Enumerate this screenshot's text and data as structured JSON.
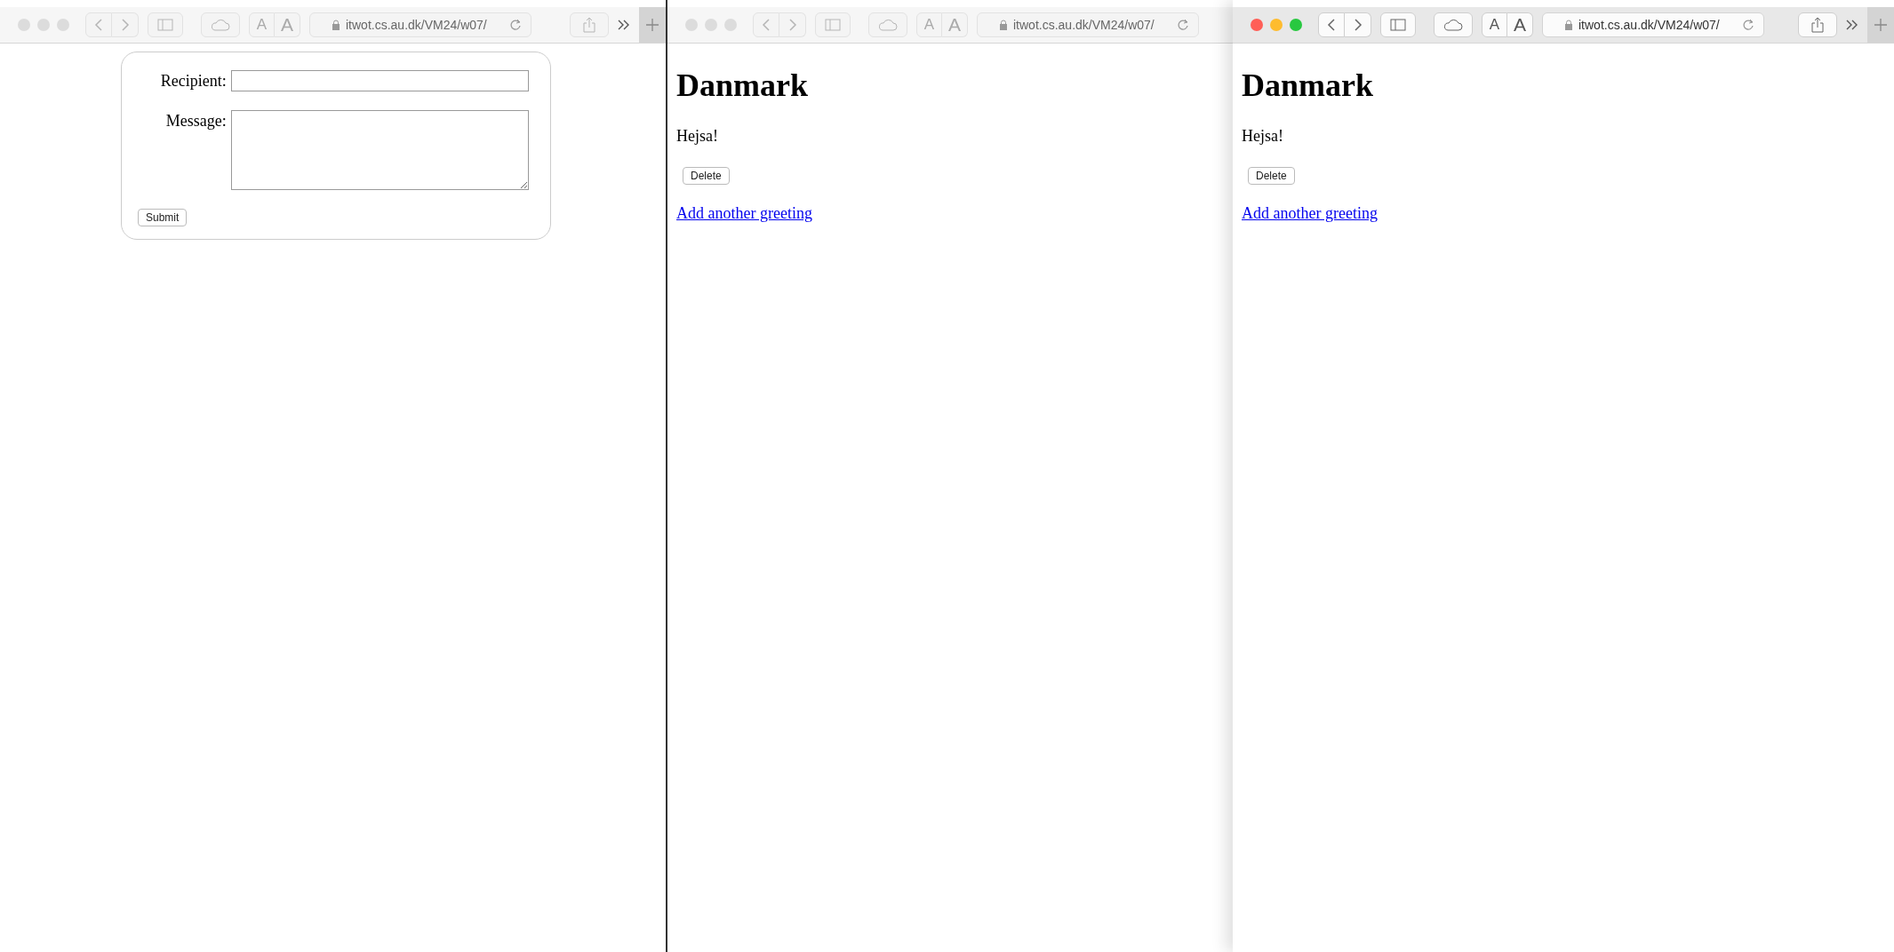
{
  "windows": [
    {
      "active": false,
      "toolbar": {
        "text_size_buttons": [
          "A",
          "A"
        ],
        "url": "itwot.cs.au.dk/VM24/w07/",
        "show_right_buttons": true
      },
      "page": {
        "kind": "form",
        "fields": [
          {
            "label": "Recipient:",
            "kind": "input"
          },
          {
            "label": "Message:",
            "kind": "textarea"
          }
        ],
        "button": "Submit"
      }
    },
    {
      "active": false,
      "toolbar": {
        "text_size_buttons": [
          "A",
          "A"
        ],
        "url": "itwot.cs.au.dk/VM24/w07/",
        "show_right_buttons": false
      },
      "page": {
        "kind": "greeting",
        "heading": "Danmark",
        "text": "Hejsa!",
        "button": "Delete",
        "link": "Add another greeting"
      }
    },
    {
      "active": true,
      "toolbar": {
        "text_size_buttons": [
          "A",
          "A"
        ],
        "url": "itwot.cs.au.dk/VM24/w07/",
        "show_right_buttons": true
      },
      "page": {
        "kind": "greeting",
        "heading": "Danmark",
        "text": "Hejsa!",
        "button": "Delete",
        "link": "Add another greeting"
      }
    }
  ]
}
